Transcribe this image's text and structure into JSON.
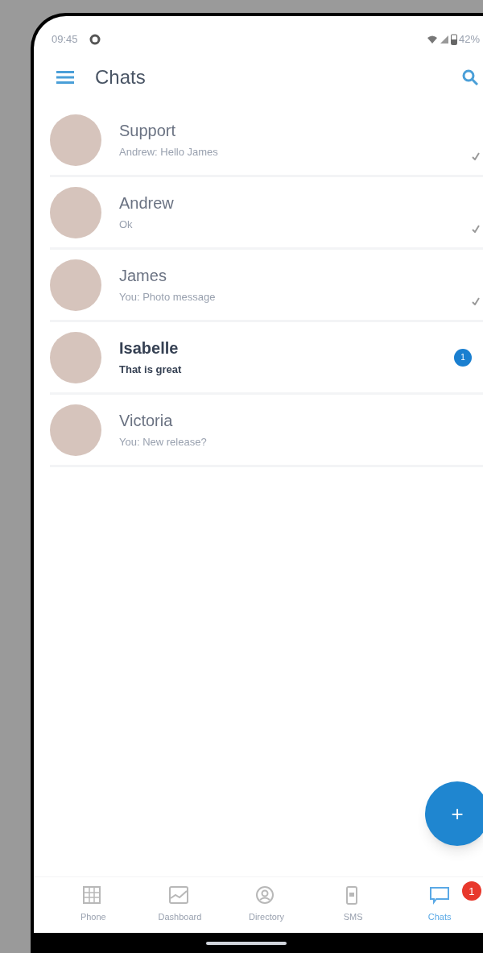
{
  "status_bar": {
    "time": "09:45",
    "battery": "42%"
  },
  "app_bar": {
    "title": "Chats"
  },
  "chats": [
    {
      "name": "Support",
      "preview": "Andrew: Hello James",
      "unread": false,
      "delivered": true
    },
    {
      "name": "Andrew",
      "preview": "Ok",
      "unread": false,
      "delivered": true
    },
    {
      "name": "James",
      "preview": "You: Photo message",
      "unread": false,
      "delivered": true
    },
    {
      "name": "Isabelle",
      "preview": "That is great",
      "unread": true,
      "badge": "1",
      "delivered": false
    },
    {
      "name": "Victoria",
      "preview": "You: New release?",
      "unread": false,
      "delivered": false
    }
  ],
  "fab": {
    "label": "+"
  },
  "nav": [
    {
      "kind": "phone",
      "label": "Phone",
      "selected": false
    },
    {
      "kind": "dashboard",
      "label": "Dashboard",
      "selected": false
    },
    {
      "kind": "directory",
      "label": "Directory",
      "selected": false
    },
    {
      "kind": "sms",
      "label": "SMS",
      "selected": false
    },
    {
      "kind": "chats",
      "label": "Chats",
      "selected": true,
      "badge": "1"
    }
  ]
}
